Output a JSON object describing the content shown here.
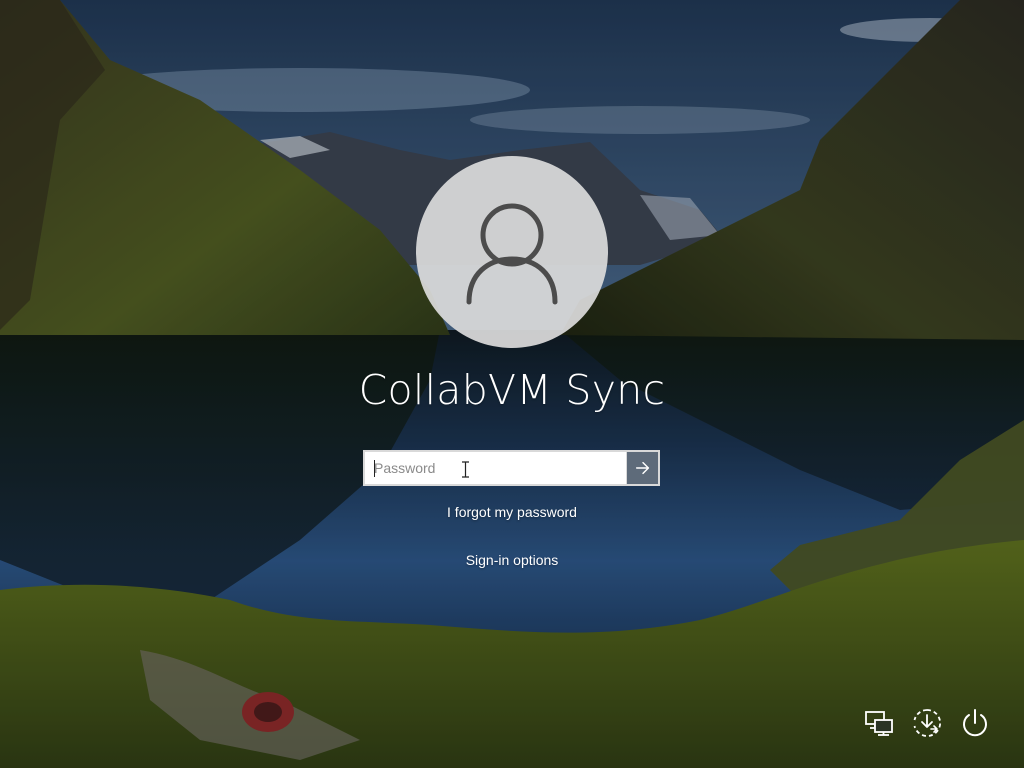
{
  "lock_screen": {
    "user_name": "CollabVM Sync",
    "avatar_icon": "user-silhouette-icon",
    "password": {
      "value": "",
      "placeholder": "Password",
      "submit_icon": "arrow-right-icon"
    },
    "forgot_password_label": "I forgot my password",
    "sign_in_options_label": "Sign-in options"
  },
  "system_tray": {
    "icons": [
      "network-icon",
      "ease-of-access-icon",
      "power-icon"
    ]
  },
  "colors": {
    "submit_button": "#5e6b7a",
    "text": "#ffffff",
    "avatar_bg": "#dadada",
    "input_border": "#d9d9d9"
  }
}
